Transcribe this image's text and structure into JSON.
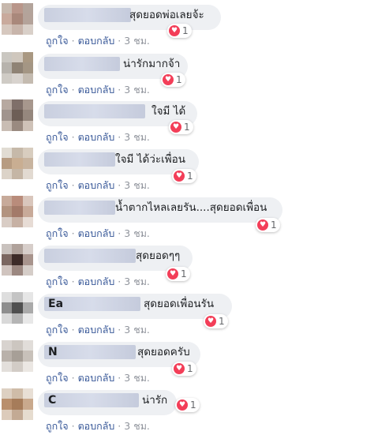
{
  "actions": {
    "like": "ถูกใจ",
    "reply": "ตอบกลับ",
    "sep": "·"
  },
  "colors": {
    "heart": "#f33e58",
    "link": "#385898",
    "bubble": "#eef0f3"
  },
  "comments": [
    {
      "name_visible": "",
      "text": "สุดยอดพ่อเลยจ้ะ",
      "reactions": "1",
      "time": "3 ชม."
    },
    {
      "name_visible": "",
      "text": "น่ารักมากจ้า",
      "reactions": "1",
      "time": "3 ชม."
    },
    {
      "name_visible": "",
      "text": "ใจมี ได้",
      "reactions": "1",
      "time": "3 ชม."
    },
    {
      "name_visible": "",
      "text": "ใจมี ได้ว่ะเพื่อน",
      "reactions": "1",
      "time": "3 ชม."
    },
    {
      "name_visible": "",
      "text": "น้ำตากไหลเลยรัน....สุดยอดเพื่อน",
      "reactions": "1",
      "time": "3 ชม."
    },
    {
      "name_visible": "",
      "text": "สุดยอดๆๆ",
      "reactions": "1",
      "time": "3 ชม."
    },
    {
      "name_visible": "Ea",
      "text": "สุดยอดเพื่อนรัน",
      "reactions": "1",
      "time": "3 ชม."
    },
    {
      "name_visible": "N",
      "text": "สุดยอดครับ",
      "reactions": "1",
      "time": "3 ชม."
    },
    {
      "name_visible": "C",
      "text": "น่ารัก",
      "reactions": "1",
      "time": "3 ชม."
    }
  ]
}
